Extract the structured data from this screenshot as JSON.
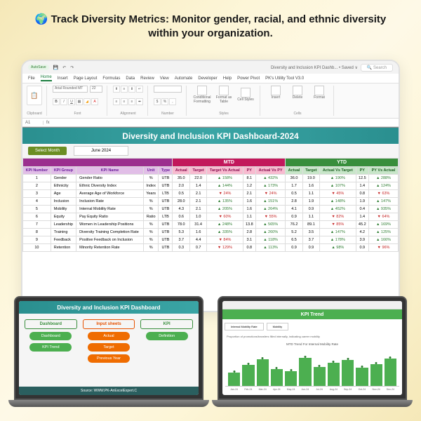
{
  "headline": "🌍 Track Diversity Metrics: Monitor gender, racial, and ethnic diversity within your organization.",
  "titlebar": {
    "autosave": "AutoSave",
    "filename": "Diversity and Inclusion KPI Dashb... • Saved ∨",
    "search": "Search"
  },
  "ribbon": {
    "tabs": [
      "File",
      "Home",
      "Insert",
      "Page Layout",
      "Formulas",
      "Data",
      "Review",
      "View",
      "Automate",
      "Developer",
      "Help",
      "Power Pivot",
      "PK's Utility Tool V3.0"
    ],
    "groups": {
      "clipboard": "Clipboard",
      "font": "Font",
      "alignment": "Alignment",
      "number": "Number",
      "styles": "Styles",
      "cells": "Cells"
    },
    "font_name": "Arial Rounded MT",
    "font_size": "22",
    "cells_btns": [
      "Insert",
      "Delete",
      "Format"
    ],
    "styles_btns": [
      "Conditional Formatting",
      "Format as Table",
      "Cell Styles"
    ]
  },
  "formula": {
    "cell": "A1",
    "fx": "fx"
  },
  "dashboard": {
    "title": "Diversity and Inclusion KPI Dashboard-2024",
    "select_month": "Select Month",
    "month": "June 2024",
    "sections": {
      "kpi": "",
      "mtd": "MTD",
      "ytd": "YTD"
    },
    "cols": {
      "num": "KPI Number",
      "group": "KPI Group",
      "name": "KPI Name",
      "unit": "Unit",
      "type": "Type",
      "actual": "Actual",
      "target": "Target",
      "tva": "Target Vs\nActual",
      "py": "PY",
      "avp": "Actual Vs\nPY",
      "yactual": "Actual",
      "ytarget": "Target",
      "ytva": "Actual Vs\nTarget",
      "ypy": "PY",
      "ypvp": "PY Vs\nActual"
    },
    "rows": [
      {
        "n": "1",
        "g": "Gender",
        "name": "Gender Ratio",
        "u": "%",
        "t": "UTB",
        "ma": "35.0",
        "mt": "22.0",
        "mtva": "▲ 158%",
        "mpy": "8.1",
        "mavp": "▲ 432%",
        "ya": "36.0",
        "yt": "19.0",
        "ytva": "▲ 190%",
        "ypy": "12.5",
        "ypvp": "▲ 288%"
      },
      {
        "n": "2",
        "g": "Ethnicity",
        "name": "Ethnic Diversity Index",
        "u": "Index",
        "t": "UTB",
        "ma": "2.0",
        "mt": "1.4",
        "mtva": "▲ 144%",
        "mpy": "1.2",
        "mavp": "▲ 173%",
        "ya": "1.7",
        "yt": "1.6",
        "ytva": "▲ 107%",
        "ypy": "1.4",
        "ypvp": "▲ 124%"
      },
      {
        "n": "3",
        "g": "Age",
        "name": "Average Age of Workforce",
        "u": "Years",
        "t": "LTB",
        "ma": "0.5",
        "mt": "2.1",
        "mtva": "▼ 24%",
        "mpy": "2.1",
        "mavp": "▼ 24%",
        "ya": "0.5",
        "yt": "1.1",
        "ytva": "▼ 45%",
        "ypy": "0.8",
        "ypvp": "▼ 63%"
      },
      {
        "n": "4",
        "g": "Inclusion",
        "name": "Inclusion Rate",
        "u": "%",
        "t": "UTB",
        "ma": "28.0",
        "mt": "2.1",
        "mtva": "▲ 135%",
        "mpy": "1.6",
        "mavp": "▲ 151%",
        "ya": "2.8",
        "yt": "1.9",
        "ytva": "▲ 148%",
        "ypy": "1.9",
        "ypvp": "▲ 147%"
      },
      {
        "n": "5",
        "g": "Mobility",
        "name": "Internal Mobility Rate",
        "u": "%",
        "t": "UTB",
        "ma": "4.3",
        "mt": "2.1",
        "mtva": "▲ 205%",
        "mpy": "1.6",
        "mavp": "▲ 264%",
        "ya": "4.1",
        "yt": "0.9",
        "ytva": "▲ 452%",
        "ypy": "0.4",
        "ypvp": "▲ 935%"
      },
      {
        "n": "6",
        "g": "Equity",
        "name": "Pay Equity Ratio",
        "u": "Ratio",
        "t": "LTB",
        "ma": "0.6",
        "mt": "1.0",
        "mtva": "▼ 60%",
        "mpy": "1.1",
        "mavp": "▼ 55%",
        "ya": "0.9",
        "yt": "1.1",
        "ytva": "▼ 82%",
        "ypy": "1.4",
        "ypvp": "▼ 64%"
      },
      {
        "n": "7",
        "g": "Leadership",
        "name": "Women in Leadership Positions",
        "u": "%",
        "t": "UTB",
        "ma": "78.0",
        "mt": "31.4",
        "mtva": "▲ 248%",
        "mpy": "13.8",
        "mavp": "▲ 565%",
        "ya": "76.2",
        "yt": "89.1",
        "ytva": "▼ 85%",
        "ypy": "45.2",
        "ypvp": "▲ 169%"
      },
      {
        "n": "8",
        "g": "Training",
        "name": "Diversity Training Completion Rate",
        "u": "%",
        "t": "UTB",
        "ma": "5.3",
        "mt": "1.6",
        "mtva": "▲ 335%",
        "mpy": "2.8",
        "mavp": "▲ 260%",
        "ya": "5.2",
        "yt": "3.5",
        "ytva": "▲ 147%",
        "ypy": "4.2",
        "ypvp": "▲ 125%"
      },
      {
        "n": "9",
        "g": "Feedback",
        "name": "Positive Feedback on Inclusion",
        "u": "%",
        "t": "UTB",
        "ma": "3.7",
        "mt": "4.4",
        "mtva": "▼ 84%",
        "mpy": "3.1",
        "mavp": "▲ 118%",
        "ya": "6.5",
        "yt": "3.7",
        "ytva": "▲ 178%",
        "ypy": "3.9",
        "ypvp": "▲ 166%"
      },
      {
        "n": "10",
        "g": "Retention",
        "name": "Minority Retention Rate",
        "u": "%",
        "t": "UTB",
        "ma": "0.3",
        "mt": "0.7",
        "mtva": "▼ 129%",
        "mpy": "0.8",
        "mavp": "▲ 113%",
        "ya": "0.9",
        "yt": "0.9",
        "ytva": "▲ 98%",
        "ypy": "0.9",
        "ypvp": "▼ 96%"
      }
    ]
  },
  "sheet2": {
    "title": "Diversity and Inclusion KPI Dashboard",
    "cols": [
      {
        "title": "Dashboard",
        "btns": [
          "Dashboard",
          "KPI Trend"
        ],
        "class": "d",
        "btnclass": "btn-green"
      },
      {
        "title": "Input sheets",
        "btns": [
          "Actual",
          "Target",
          "Previous Year"
        ],
        "class": "i",
        "btnclass": "btn-orange"
      },
      {
        "title": "KPI",
        "btns": [
          "Definition"
        ],
        "class": "k",
        "btnclass": "btn-green"
      }
    ],
    "footer": "Source: WWW.PK-AnExcelExpert.C"
  },
  "sheet3": {
    "title": "KPI Trend",
    "sel1": "Internal Mobility Rate",
    "sel2": "Mobility",
    "desc": "Proportion of promotions/transfers filled internally, indicating career mobility",
    "chart_title": "MTD Trend For Internal Mobility Rate",
    "months": [
      "Jan-24",
      "Feb-24",
      "Mar-24",
      "Apr-24",
      "May-24",
      "Jun-24",
      "Jul-24",
      "Aug-24",
      "Sep-24",
      "Oct-24",
      "Nov-24",
      "Dec-24"
    ]
  },
  "chart_data": {
    "type": "bar",
    "title": "MTD Trend For Internal Mobility Rate",
    "categories": [
      "Jan-24",
      "Feb-24",
      "Mar-24",
      "Apr-24",
      "May-24",
      "Jun-24",
      "Jul-24",
      "Aug-24",
      "Sep-24",
      "Oct-24",
      "Nov-24",
      "Dec-24"
    ],
    "values": [
      35,
      55,
      70,
      45,
      38,
      75,
      50,
      62,
      68,
      48,
      58,
      72
    ],
    "xlabel": "",
    "ylabel": "",
    "ylim": [
      0,
      100
    ]
  }
}
